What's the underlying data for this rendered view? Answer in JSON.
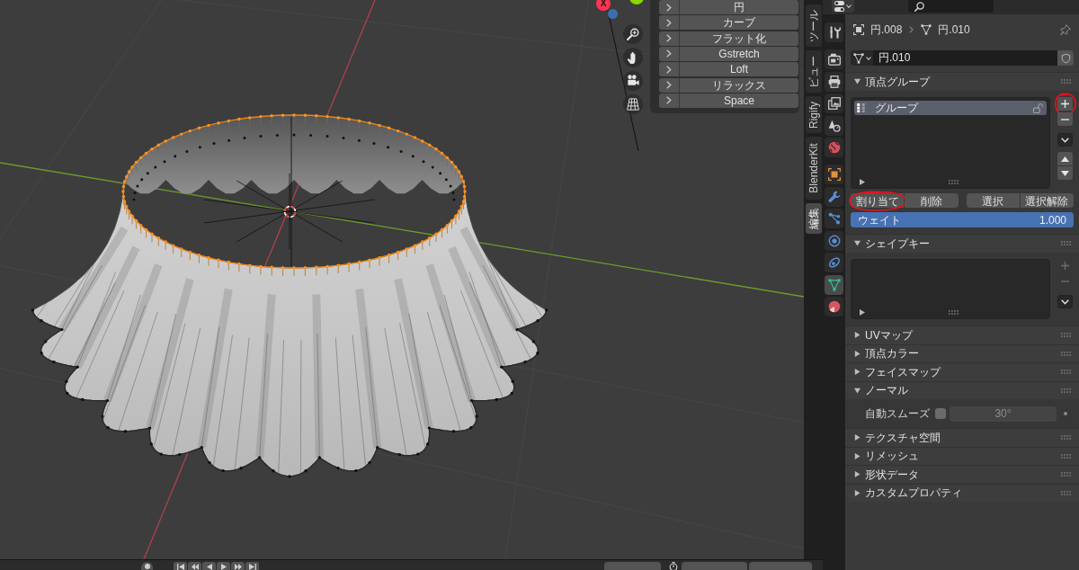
{
  "viewport": {
    "axis_gizmo": {
      "x_label": "X"
    }
  },
  "operator_menu": {
    "items": [
      {
        "label": "円",
        "expanded": false
      },
      {
        "label": "カーブ",
        "expanded": false
      },
      {
        "label": "フラット化",
        "expanded": false
      },
      {
        "label": "Gstretch",
        "expanded": false
      },
      {
        "label": "Loft",
        "expanded": false
      },
      {
        "label": "リラックス",
        "expanded": false
      },
      {
        "label": "Space",
        "expanded": false
      }
    ]
  },
  "sidebar_tabs": [
    {
      "label": "ツール",
      "selected": false
    },
    {
      "label": "ビュー",
      "selected": false
    },
    {
      "label": "Rigify",
      "selected": false
    },
    {
      "label": "BlenderKit",
      "selected": false
    },
    {
      "label": "編集",
      "selected": true
    }
  ],
  "properties": {
    "tab_groups": [
      {
        "tabs": [
          {
            "kind": "tool",
            "selected": false
          }
        ]
      },
      {
        "tabs": [
          {
            "kind": "render",
            "selected": false
          },
          {
            "kind": "output",
            "selected": false
          },
          {
            "kind": "view_layer",
            "selected": false
          },
          {
            "kind": "scene",
            "selected": false
          },
          {
            "kind": "world",
            "selected": false
          }
        ]
      },
      {
        "tabs": [
          {
            "kind": "object",
            "selected": false
          },
          {
            "kind": "modifier",
            "selected": false
          },
          {
            "kind": "particles",
            "selected": false
          },
          {
            "kind": "physics",
            "selected": false
          },
          {
            "kind": "constraint",
            "selected": false
          },
          {
            "kind": "data",
            "selected": true
          },
          {
            "kind": "material",
            "selected": false
          }
        ]
      }
    ],
    "breadcrumb": [
      {
        "kind": "object",
        "label": "円.008"
      },
      {
        "kind": "mesh",
        "label": "円.010"
      }
    ],
    "mesh_name": "円.010",
    "panels": [
      {
        "kind": "vertex_groups",
        "title": "頂点グループ",
        "expanded": true,
        "items": [
          {
            "label": "グループ",
            "selected": true,
            "locked": false
          }
        ],
        "side_buttons": [
          {
            "kind": "add",
            "disabled": false,
            "circled": true
          },
          {
            "kind": "remove",
            "disabled": false,
            "circled": false
          },
          {
            "kind": "menu",
            "disabled": false,
            "circled": false
          },
          {
            "kind": "move_up",
            "disabled": false,
            "circled": false
          },
          {
            "kind": "move_down",
            "disabled": false,
            "circled": false
          }
        ],
        "button_groups": [
          {
            "buttons": [
              {
                "label": "割り当て",
                "circled": true
              },
              {
                "label": "削除",
                "circled": false
              }
            ]
          },
          {
            "buttons": [
              {
                "label": "選択",
                "circled": false
              },
              {
                "label": "選択解除",
                "circled": false
              }
            ]
          }
        ],
        "weight": {
          "label": "ウェイト",
          "value": "1.000",
          "level": 1
        }
      },
      {
        "kind": "shape_keys",
        "title": "シェイプキー",
        "expanded": true,
        "side_buttons": [
          {
            "kind": "add",
            "disabled": true,
            "circled": false
          },
          {
            "kind": "remove",
            "disabled": true,
            "circled": false
          },
          {
            "kind": "menu",
            "disabled": false,
            "circled": false
          }
        ]
      },
      {
        "kind": "plain",
        "title": "UVマップ",
        "expanded": false
      },
      {
        "kind": "plain",
        "title": "頂点カラー",
        "expanded": false
      },
      {
        "kind": "plain",
        "title": "フェイスマップ",
        "expanded": false
      },
      {
        "kind": "normals",
        "title": "ノーマル",
        "expanded": true,
        "auto_smooth": {
          "label": "自動スムーズ",
          "checked": false,
          "angle": "30°"
        }
      },
      {
        "kind": "plain",
        "title": "テクスチャ空間",
        "expanded": false
      },
      {
        "kind": "plain",
        "title": "リメッシュ",
        "expanded": false
      },
      {
        "kind": "plain",
        "title": "形状データ",
        "expanded": false
      },
      {
        "kind": "plain",
        "title": "カスタムプロパティ",
        "expanded": false
      }
    ]
  }
}
